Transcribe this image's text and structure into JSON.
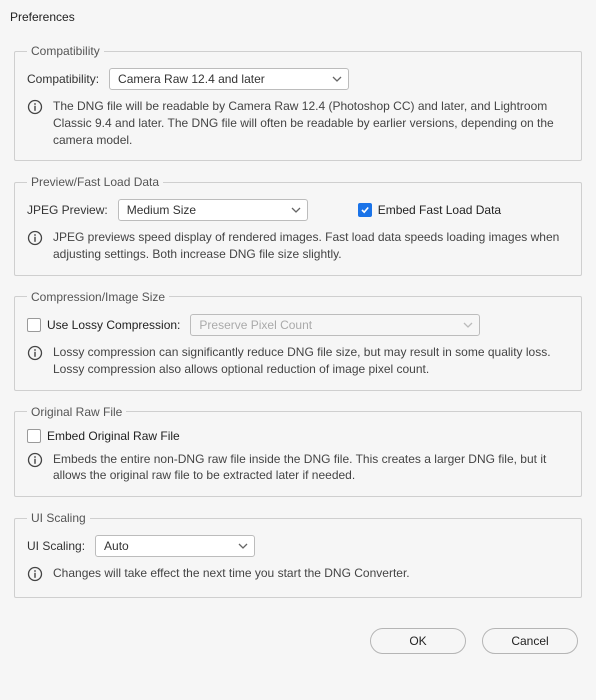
{
  "window_title": "Preferences",
  "compatibility": {
    "legend": "Compatibility",
    "label": "Compatibility:",
    "value": "Camera Raw 12.4 and later",
    "info": "The DNG file will be readable by Camera Raw 12.4 (Photoshop CC) and later, and Lightroom Classic 9.4 and later. The DNG file will often be readable by earlier versions, depending on the camera model."
  },
  "preview": {
    "legend": "Preview/Fast Load Data",
    "label": "JPEG Preview:",
    "value": "Medium Size",
    "embed_label": "Embed Fast Load Data",
    "embed_checked": true,
    "info": "JPEG previews speed display of rendered images.  Fast load data speeds loading images when adjusting settings.  Both increase DNG file size slightly."
  },
  "compression": {
    "legend": "Compression/Image Size",
    "lossy_label": "Use Lossy Compression:",
    "lossy_checked": false,
    "pixel_value": "Preserve Pixel Count",
    "info": "Lossy compression can significantly reduce DNG file size, but may result in some quality loss.  Lossy compression also allows optional reduction of image pixel count."
  },
  "original": {
    "legend": "Original Raw File",
    "embed_label": "Embed Original Raw File",
    "embed_checked": false,
    "info": "Embeds the entire non-DNG raw file inside the DNG file.  This creates a larger DNG file, but it allows the original raw file to be extracted later if needed."
  },
  "uiscaling": {
    "legend": "UI Scaling",
    "label": "UI Scaling:",
    "value": "Auto",
    "info": "Changes will take effect the next time you start the DNG Converter."
  },
  "buttons": {
    "ok": "OK",
    "cancel": "Cancel"
  }
}
